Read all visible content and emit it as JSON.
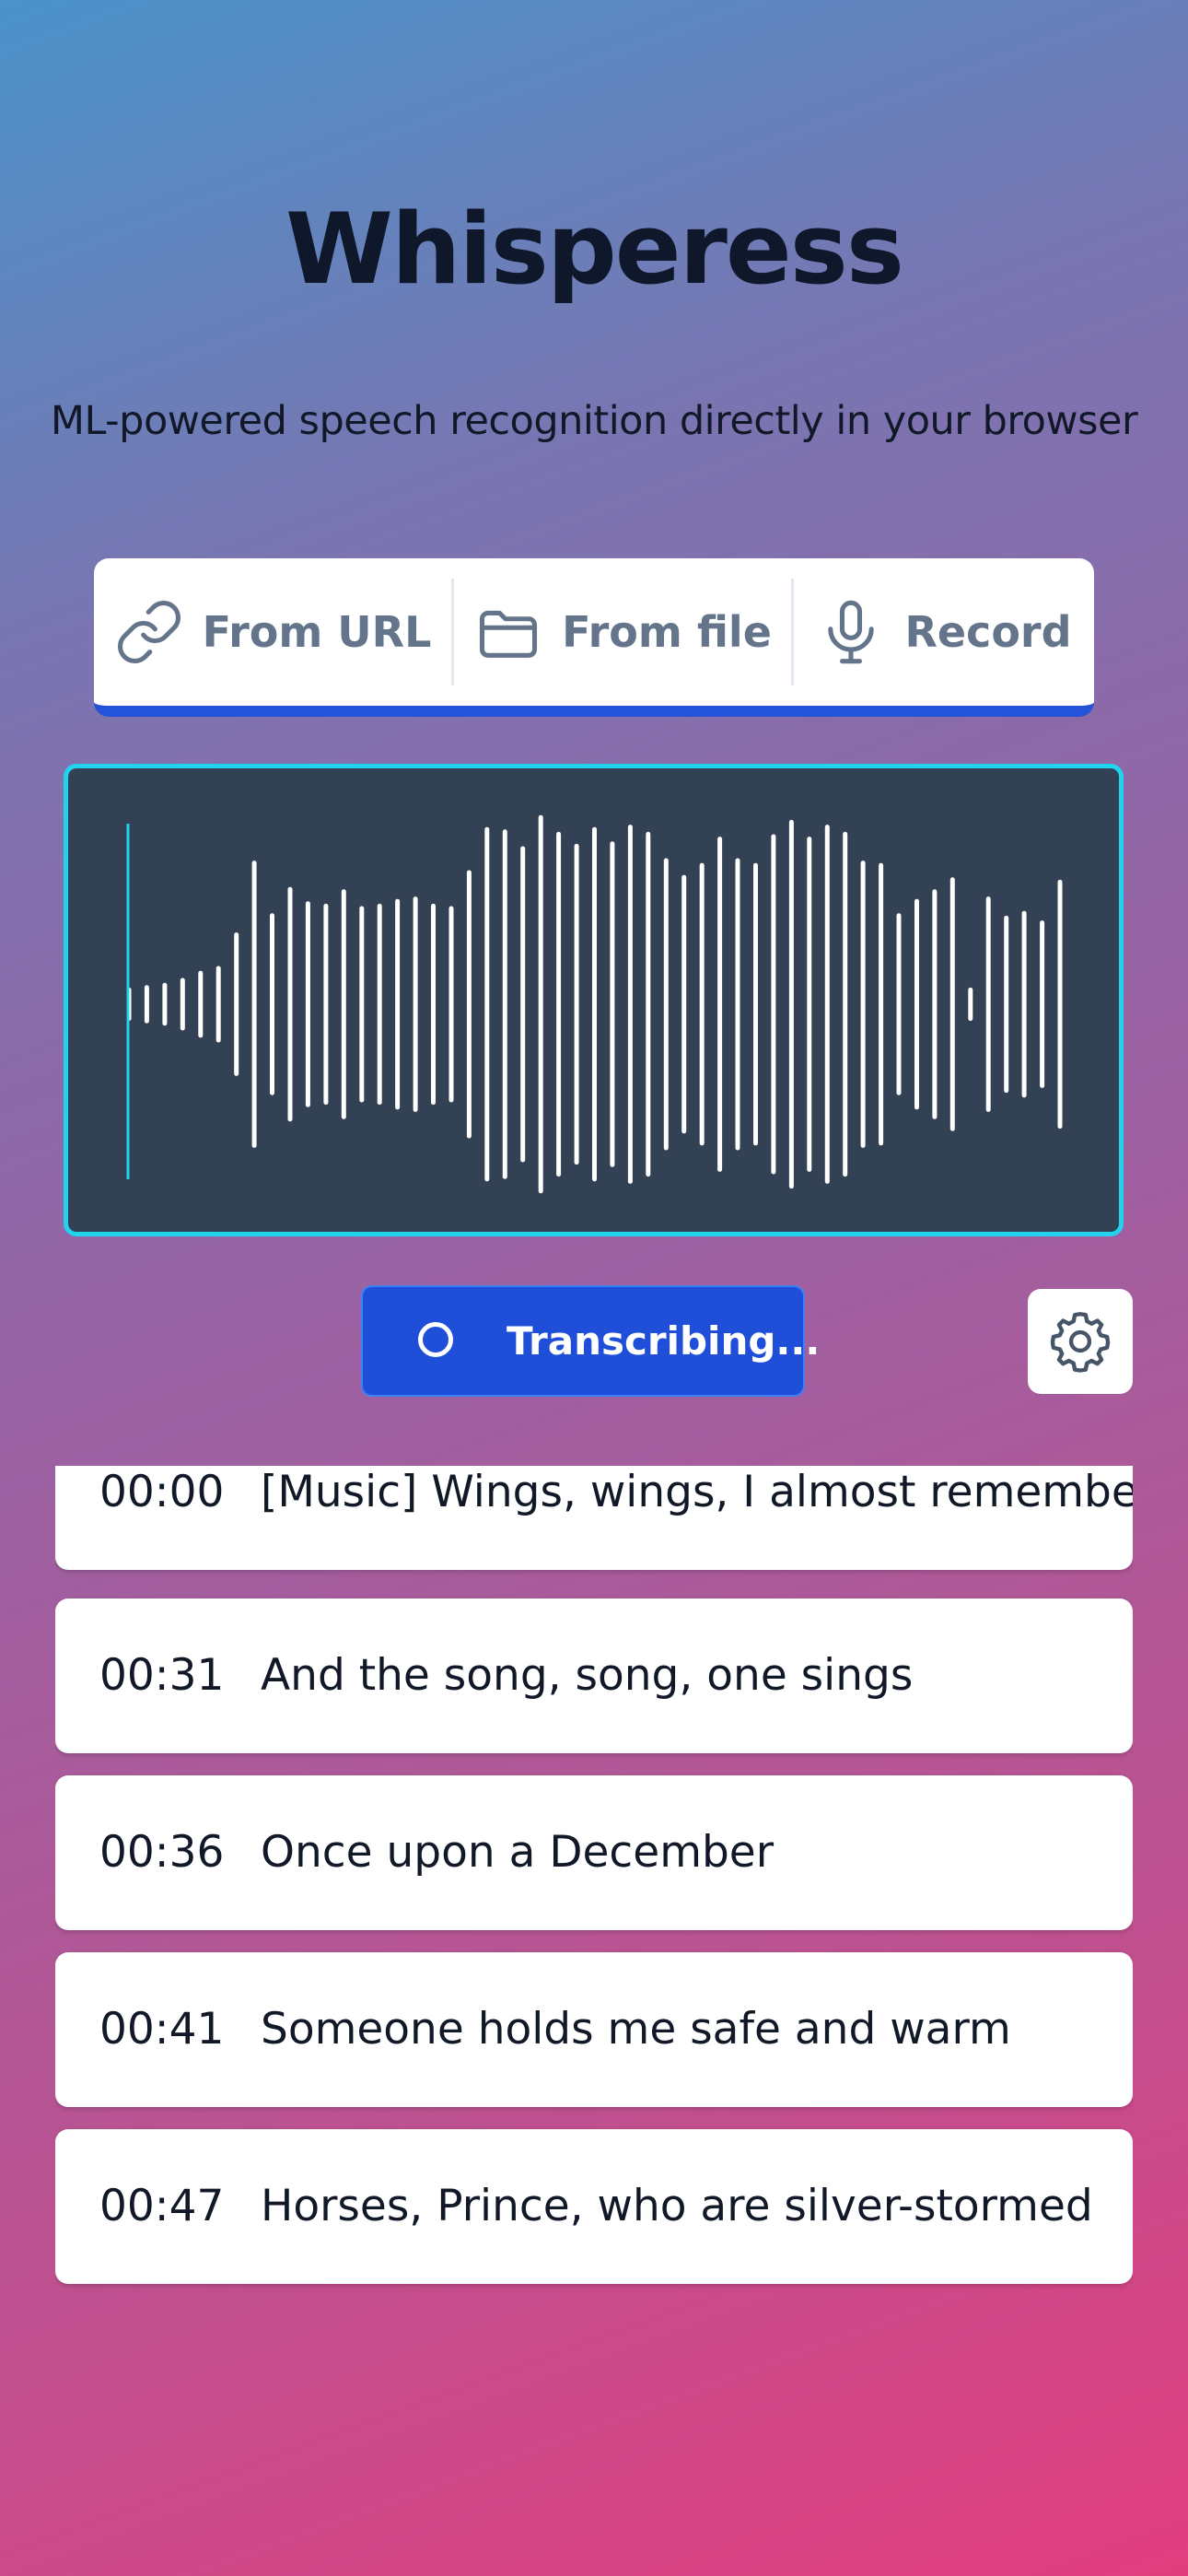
{
  "header": {
    "title": "Whisperess",
    "subtitle": "ML-powered speech recognition directly in your browser"
  },
  "source_tabs": [
    {
      "label": "From URL",
      "icon": "link-icon"
    },
    {
      "label": "From file",
      "icon": "folder-icon"
    },
    {
      "label": "Record",
      "icon": "microphone-icon"
    }
  ],
  "waveform": {
    "bar_heights": [
      0.12,
      0.14,
      0.16,
      0.2,
      0.26,
      0.3,
      0.58,
      1.18,
      0.74,
      0.96,
      0.84,
      0.82,
      0.94,
      0.8,
      0.82,
      0.86,
      0.88,
      0.82,
      0.8,
      1.1,
      1.46,
      1.44,
      1.3,
      1.56,
      1.42,
      1.32,
      1.46,
      1.34,
      1.48,
      1.42,
      1.2,
      1.06,
      1.16,
      1.38,
      1.2,
      1.16,
      1.4,
      1.52,
      1.38,
      1.48,
      1.42,
      1.18,
      1.16,
      0.74,
      0.86,
      0.94,
      1.04,
      0.12,
      0.88,
      0.72,
      0.76,
      0.68,
      1.02
    ],
    "playhead": 0,
    "accent_color": "#22d3ee"
  },
  "controls": {
    "transcribe_label": "Transcribing...",
    "settings_icon": "gear-icon"
  },
  "transcript": [
    {
      "time": "00:00",
      "text": "[Music] Wings, wings, I almost remember"
    },
    {
      "time": "00:31",
      "text": "And the song, song, one sings"
    },
    {
      "time": "00:36",
      "text": "Once upon a December"
    },
    {
      "time": "00:41",
      "text": "Someone holds me safe and warm"
    },
    {
      "time": "00:47",
      "text": "Horses, Prince, who are silver-stormed"
    }
  ]
}
